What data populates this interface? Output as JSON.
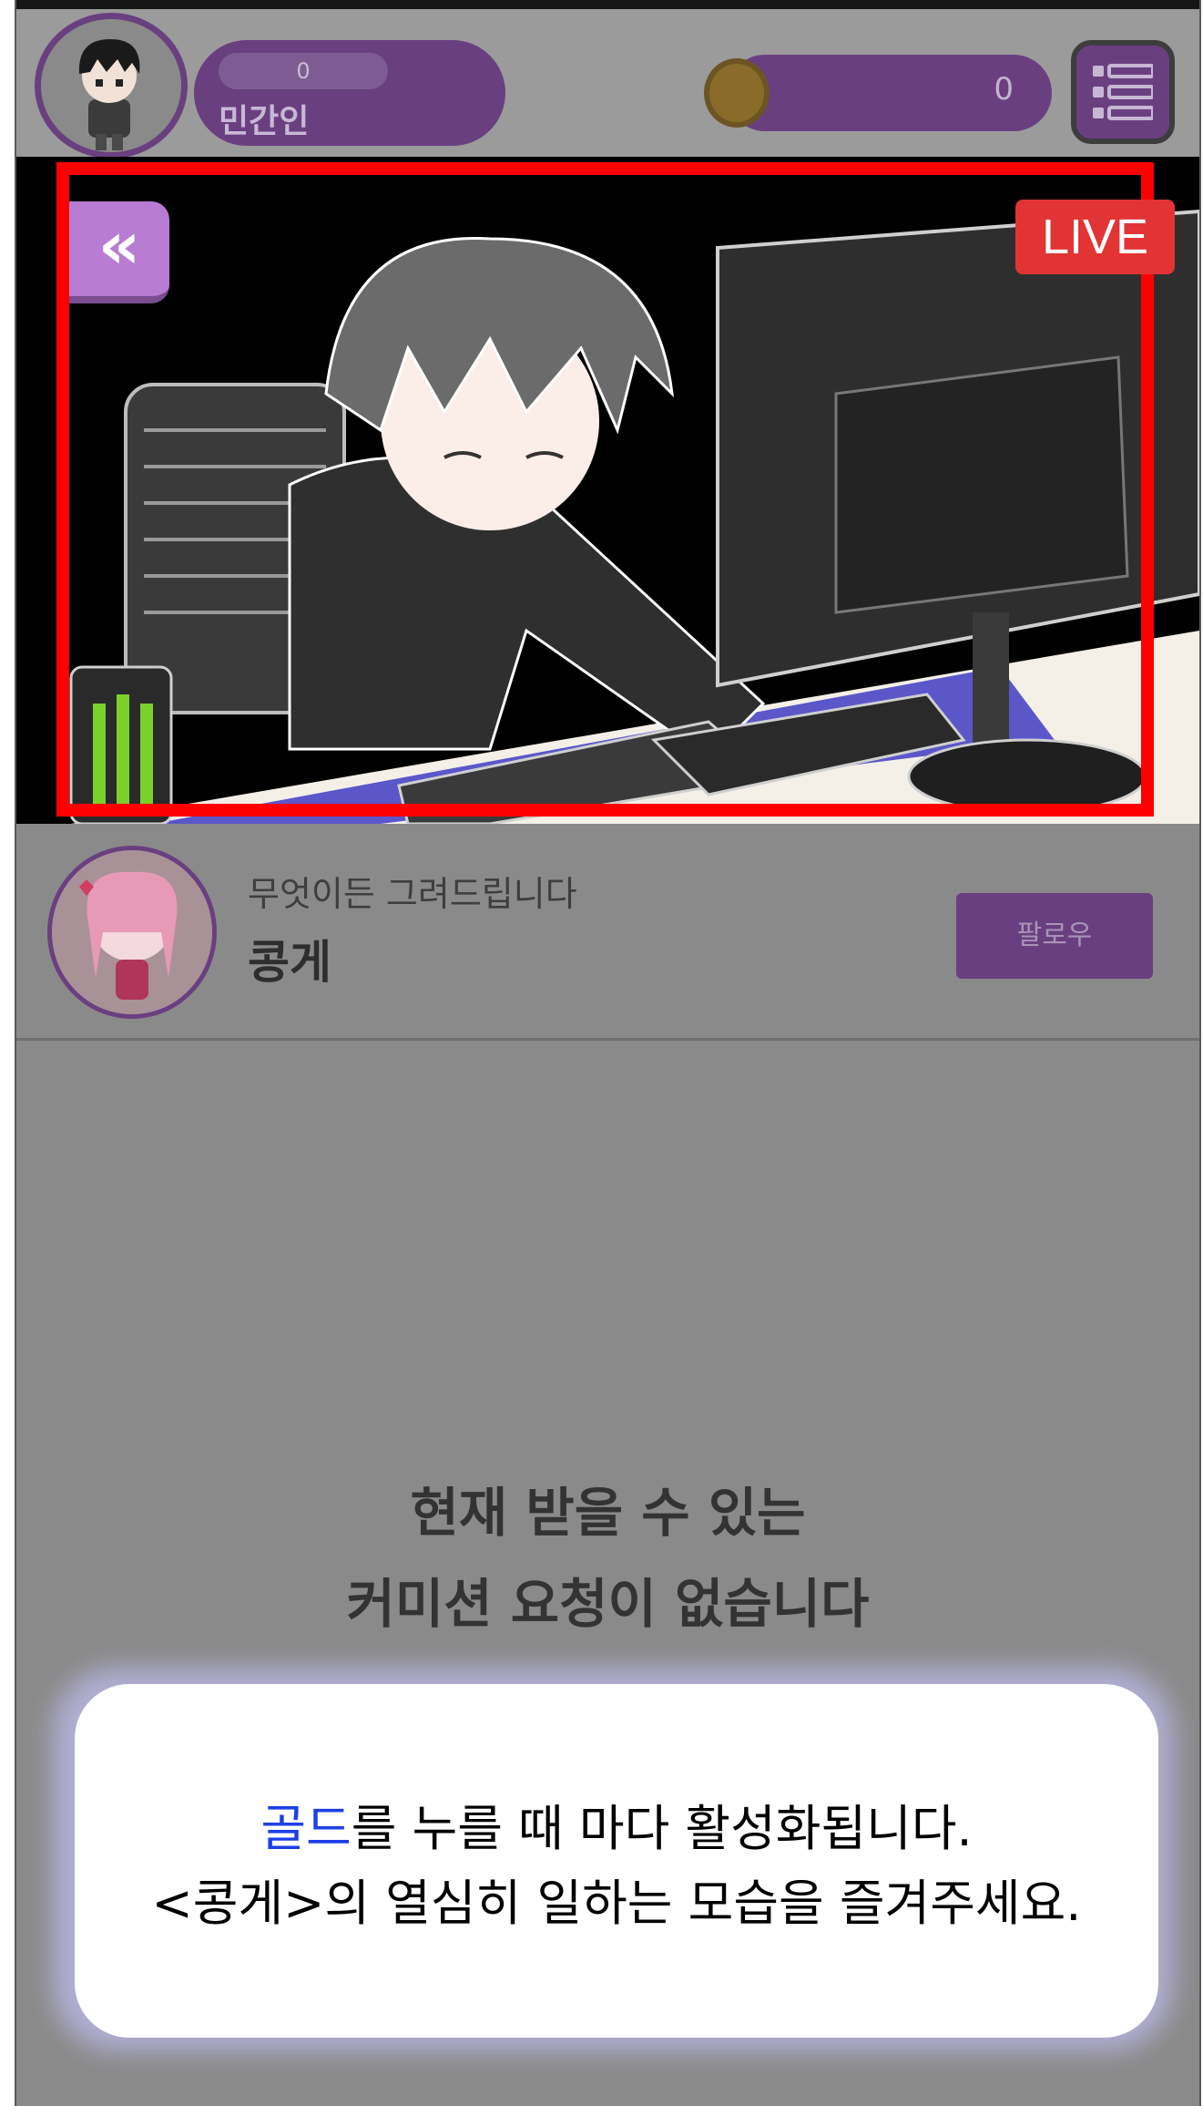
{
  "hud": {
    "level": "0",
    "player_name": "민간인",
    "gold": "0",
    "icons": {
      "menu": "list-menu-icon",
      "coin": "gold-coin-icon",
      "avatar": "player-avatar"
    }
  },
  "stream": {
    "back_label": "«",
    "live_label": "LIVE",
    "colors": {
      "frame": "#ff0000",
      "live": "#e23434",
      "back": "#b87dd2"
    }
  },
  "streamer": {
    "description": "무엇이든 그려드립니다",
    "name": "콩게",
    "follow_label": "팔로우"
  },
  "main": {
    "empty_line1": "현재 받을 수 있는",
    "empty_line2": "커미션 요청이 없습니다"
  },
  "dialog": {
    "gold_word": "골드",
    "line1_rest": "를 누를 때 마다 활성화됩니다.",
    "line2": "<콩게>의 열심히 일하는 모습을 즐겨주세요.",
    "colors": {
      "gold_word": "#1d3fe6"
    }
  }
}
